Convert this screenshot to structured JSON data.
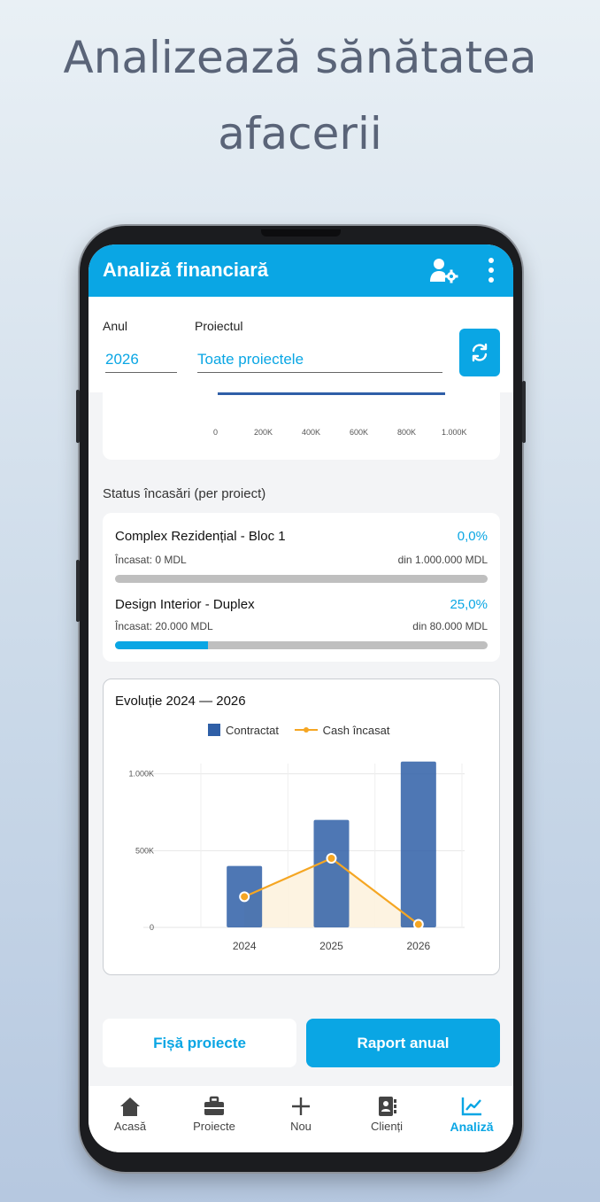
{
  "hero": {
    "line1": "Analizează sănătatea",
    "line2": "afacerii"
  },
  "appbar": {
    "title": "Analiză financiară"
  },
  "filters": {
    "year_label": "Anul",
    "year_value": "2026",
    "project_label": "Proiectul",
    "project_value": "Toate proiectele"
  },
  "top_chart": {
    "ticks": [
      "0",
      "200K",
      "400K",
      "600K",
      "800K",
      "1.000K"
    ]
  },
  "status": {
    "title": "Status încasări (per proiect)",
    "projects": [
      {
        "name": "Complex Rezidențial - Bloc 1",
        "pct": "0,0%",
        "collected": "Încasat: 0 MDL",
        "total": "din 1.000.000 MDL",
        "progress": 0.0
      },
      {
        "name": "Design Interior - Duplex",
        "pct": "25,0%",
        "collected": "Încasat: 20.000 MDL",
        "total": "din 80.000 MDL",
        "progress": 0.25
      }
    ]
  },
  "chart_data": {
    "type": "bar",
    "title": "Evoluție 2024 — 2026",
    "categories": [
      "2024",
      "2025",
      "2026"
    ],
    "series": [
      {
        "name": "Contractat",
        "type": "bar",
        "color": "#2f5fa7",
        "values": [
          400,
          700,
          1080
        ]
      },
      {
        "name": "Cash încasat",
        "type": "line",
        "color": "#f5a623",
        "values": [
          200,
          450,
          20
        ]
      }
    ],
    "yticks": [
      "0",
      "500K",
      "1.000K"
    ],
    "ylim": [
      0,
      1200
    ],
    "grid": true,
    "legend": "top-center"
  },
  "buttons": {
    "projects_sheet": "Fișă proiecte",
    "annual_report": "Raport anual"
  },
  "nav": [
    {
      "label": "Acasă",
      "icon": "home-icon"
    },
    {
      "label": "Proiecte",
      "icon": "briefcase-icon"
    },
    {
      "label": "Nou",
      "icon": "plus-icon"
    },
    {
      "label": "Clienți",
      "icon": "contacts-icon"
    },
    {
      "label": "Analiză",
      "icon": "chart-icon"
    }
  ],
  "colors": {
    "accent": "#0aa6e4",
    "bar": "#2f5fa7",
    "line": "#f5a623"
  }
}
